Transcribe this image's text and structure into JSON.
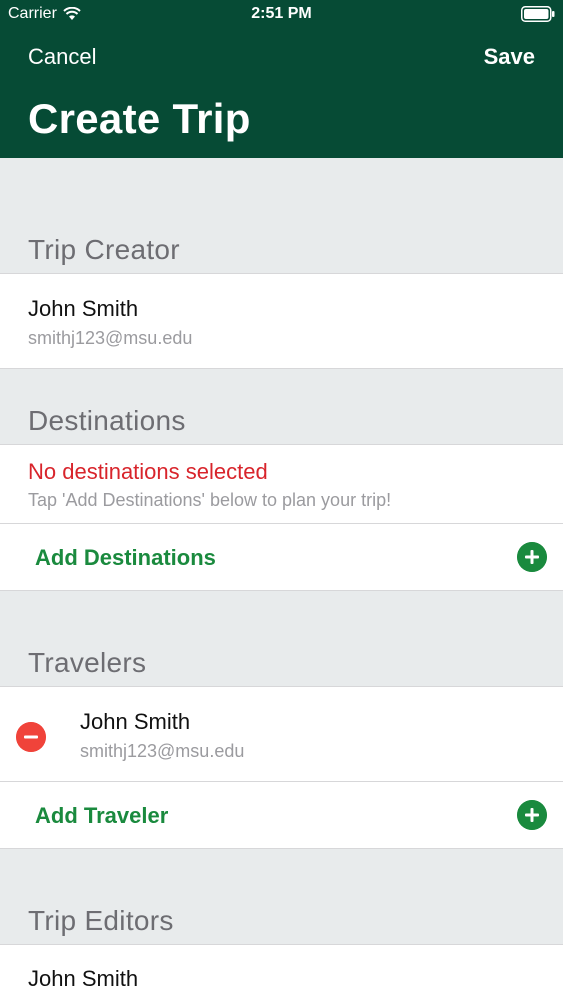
{
  "status_bar": {
    "carrier": "Carrier",
    "time": "2:51 PM"
  },
  "nav": {
    "cancel_label": "Cancel",
    "save_label": "Save",
    "title": "Create Trip"
  },
  "trip_creator": {
    "header": "Trip Creator",
    "name": "John Smith",
    "email": "smithj123@msu.edu"
  },
  "destinations": {
    "header": "Destinations",
    "empty_title": "No destinations selected",
    "empty_hint": "Tap 'Add Destinations' below to plan your trip!",
    "add_label": "Add Destinations"
  },
  "travelers": {
    "header": "Travelers",
    "items": [
      {
        "name": "John Smith",
        "email": "smithj123@msu.edu"
      }
    ],
    "add_label": "Add Traveler"
  },
  "trip_editors": {
    "header": "Trip Editors",
    "items": [
      {
        "name": "John Smith"
      }
    ]
  },
  "colors": {
    "header_bg": "#064b35",
    "accent_green": "#1a8a3e",
    "error_red": "#d8242b",
    "remove_red": "#f0433a"
  }
}
